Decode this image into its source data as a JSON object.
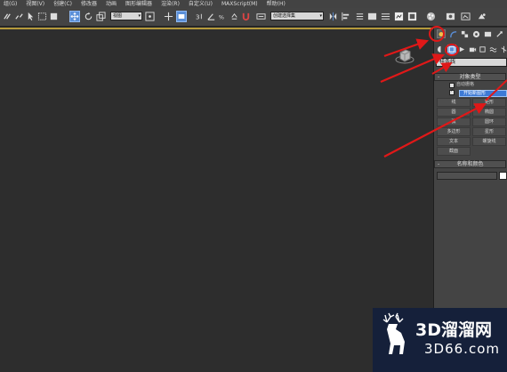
{
  "menubar": {
    "items": [
      "组(G)",
      "视图(V)",
      "创建(C)",
      "修改器",
      "动画",
      "图形编辑器",
      "渲染(R)",
      "自定义(U)",
      "MAXScript(M)",
      "帮助(H)"
    ]
  },
  "toolbar": {
    "view_dropdown": "视图",
    "selection_set": "创建选择集"
  },
  "command_panel": {
    "object_type_dropdown": "样条线",
    "rollout_object_type": "对象类型",
    "auto_grid_label": "自动栅格",
    "start_new_shape_label": "开始新图形",
    "start_new_shape_checked": true,
    "buttons": [
      "线",
      "矩形",
      "圆",
      "椭圆",
      "弧",
      "圆环",
      "多边形",
      "星形",
      "文本",
      "螺旋线",
      "截面"
    ],
    "rollout_name_color": "名称和颜色",
    "name_value": ""
  },
  "colors": {
    "accent_blue": "#5a8fd8",
    "annotation_red": "#e01818",
    "swatch": "#ffffff"
  },
  "watermark": {
    "brand": "3D溜溜网",
    "url": "3D66.com"
  }
}
